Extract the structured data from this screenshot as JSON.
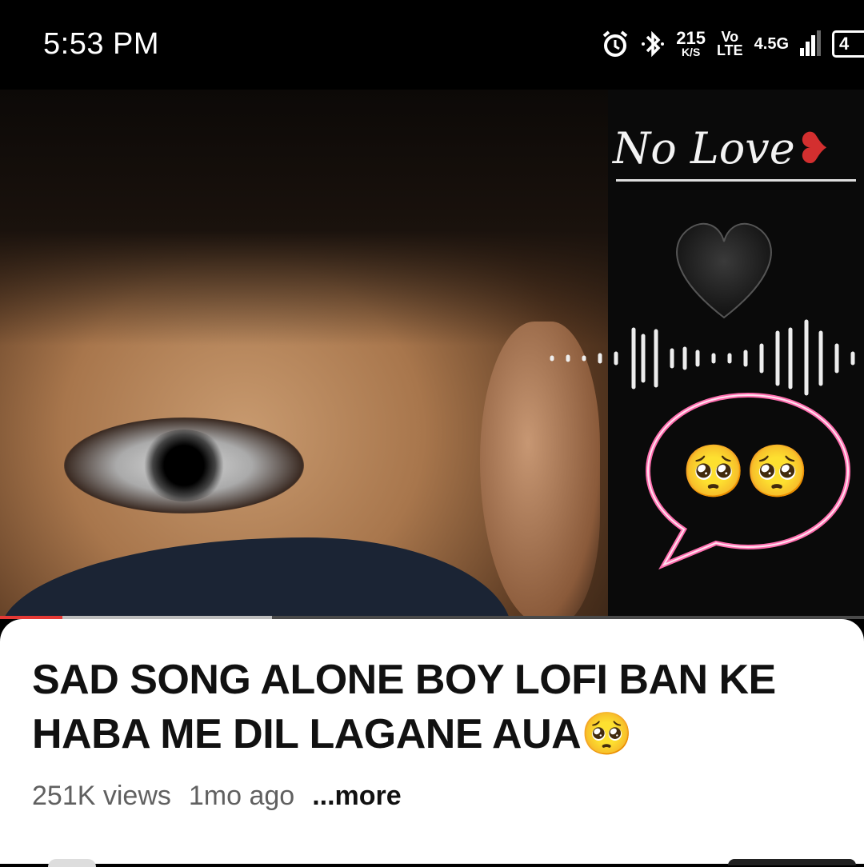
{
  "status_bar": {
    "time": "5:53 PM",
    "net_speed_value": "215",
    "net_speed_unit": "K/S",
    "volte_top": "Vo",
    "volte_bottom": "LTE",
    "network": "4.5G",
    "battery": "4"
  },
  "thumbnail": {
    "overlay_text": "No Love",
    "bubble_emojis": "🥺🥺"
  },
  "player": {
    "progress_fraction": 0.072,
    "buffer_fraction": 0.315
  },
  "video": {
    "title": "SAD SONG ALONE BOY LOFI BAN KE HABA ME DIL LAGANE AUA🥺",
    "views": "251K views",
    "age": "1mo ago",
    "more_label": "...more"
  },
  "colors": {
    "accent": "#e53935",
    "bubble_glow": "#ff6fb0"
  }
}
